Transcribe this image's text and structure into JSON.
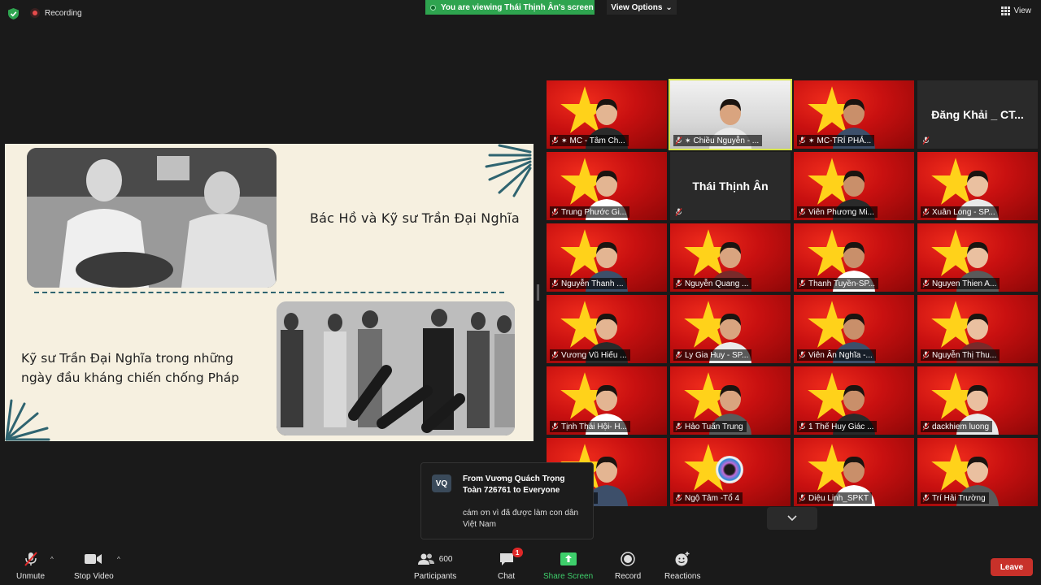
{
  "top": {
    "recording_label": "Recording",
    "viewing_banner": "You are viewing Thái Thịnh Ân's screen",
    "view_options_label": "View Options",
    "view_label": "View"
  },
  "slide": {
    "caption_top": "Bác Hồ và Kỹ sư Trần Đại Nghĩa",
    "caption_bottom_line1": "Kỹ sư Trần Đại Nghĩa trong những",
    "caption_bottom_line2": "ngày đầu kháng chiến chống Pháp"
  },
  "gallery": {
    "tiles": [
      {
        "label": "MC - Tâm Ch...",
        "type": "video",
        "pinned": true
      },
      {
        "label": "Chiều Nguyễn - ...",
        "type": "video",
        "pinned": true,
        "active": true
      },
      {
        "label": "MC-TRÍ PHẢ...",
        "type": "video",
        "pinned": true
      },
      {
        "label": "",
        "display_name": "Đăng Khải _ CT...",
        "type": "name"
      },
      {
        "label": "Trung Phước Gi...",
        "type": "video"
      },
      {
        "label": "",
        "display_name": "Thái Thịnh Ân",
        "type": "name"
      },
      {
        "label": "Viên Phương Mi...",
        "type": "video"
      },
      {
        "label": "Xuân Long - SP...",
        "type": "video"
      },
      {
        "label": "Nguyễn Thanh ...",
        "type": "video"
      },
      {
        "label": "Nguyễn Quang ...",
        "type": "video"
      },
      {
        "label": "Thanh Tuyền-SP...",
        "type": "video"
      },
      {
        "label": "Nguyen Thien A...",
        "type": "video"
      },
      {
        "label": "Vương Vũ Hiếu ...",
        "type": "video"
      },
      {
        "label": "Ly Gia Huy - SP...",
        "type": "video"
      },
      {
        "label": "Viên Ân Nghĩa -...",
        "type": "video"
      },
      {
        "label": "Nguyễn Thị Thu...",
        "type": "video"
      },
      {
        "label": "Tịnh Thái Hội- H...",
        "type": "video"
      },
      {
        "label": "Hảo Tuấn Trung",
        "type": "video"
      },
      {
        "label": "1 Thế Huy Giác ...",
        "type": "video"
      },
      {
        "label": "dackhiem luong",
        "type": "video"
      },
      {
        "label": "N TP H...",
        "type": "video"
      },
      {
        "label": "Ngộ Tâm -Tổ 4",
        "type": "video"
      },
      {
        "label": "Diệu Linh_SPKT",
        "type": "video"
      },
      {
        "label": "Trí Hải Trường",
        "type": "video"
      }
    ]
  },
  "chat_popup": {
    "avatar_initials": "VQ",
    "from": "From Vương Quách Trọng Toàn 726761 to Everyone",
    "message": "cám ơn vì đã được làm con dân Việt Nam"
  },
  "toolbar": {
    "unmute": "Unmute",
    "stop_video": "Stop Video",
    "participants": "Participants",
    "participants_count": "600",
    "chat": "Chat",
    "chat_badge": "1",
    "share_screen": "Share Screen",
    "record": "Record",
    "reactions": "Reactions",
    "leave": "Leave"
  },
  "colors": {
    "share_green": "#3ecf6b",
    "leave_red": "#c8312a",
    "banner_green": "#2ea44f",
    "active_speaker": "#d6e34a"
  }
}
